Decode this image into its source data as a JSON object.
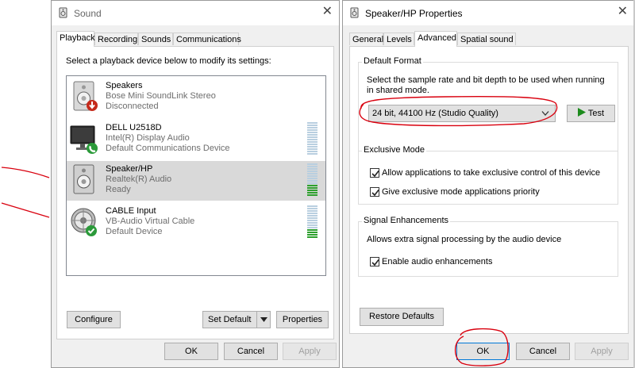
{
  "sound": {
    "title": "Sound",
    "tabs": [
      "Playback",
      "Recording",
      "Sounds",
      "Communications"
    ],
    "instruction": "Select a playback device below to modify its settings:",
    "devices": [
      {
        "name": "Speakers",
        "line2": "Bose Mini SoundLink Stereo",
        "line3": "Disconnected",
        "icon": "speaker-disconnected-icon",
        "status": "disconnected"
      },
      {
        "name": "DELL U2518D",
        "line2": "Intel(R) Display Audio",
        "line3": "Default Communications Device",
        "icon": "monitor-phone-icon",
        "status": "default-communications",
        "level": 0
      },
      {
        "name": "Speaker/HP",
        "line2": "Realtek(R) Audio",
        "line3": "Ready",
        "icon": "speaker-icon",
        "status": "ready",
        "selected": true,
        "level": 0.35
      },
      {
        "name": "CABLE Input",
        "line2": "VB-Audio Virtual Cable",
        "line3": "Default Device",
        "icon": "cable-default-icon",
        "status": "default",
        "level": 0.3
      }
    ],
    "buttons": {
      "configure": "Configure",
      "set_default": "Set Default",
      "properties": "Properties",
      "ok": "OK",
      "cancel": "Cancel",
      "apply": "Apply"
    }
  },
  "props": {
    "title": "Speaker/HP Properties",
    "tabs": [
      "General",
      "Levels",
      "Advanced",
      "Spatial sound"
    ],
    "default_format": {
      "group": "Default Format",
      "description": "Select the sample rate and bit depth to be used when running in shared mode.",
      "selected": "24 bit, 44100 Hz (Studio Quality)",
      "test": "Test"
    },
    "exclusive": {
      "group": "Exclusive Mode",
      "allow": "Allow applications to take exclusive control of this device",
      "priority": "Give exclusive mode applications priority"
    },
    "signal": {
      "group": "Signal Enhancements",
      "description": "Allows extra signal processing by the audio device",
      "enable": "Enable audio enhancements"
    },
    "restore": "Restore Defaults",
    "buttons": {
      "ok": "OK",
      "cancel": "Cancel",
      "apply": "Apply"
    }
  },
  "colors": {
    "annotation": "#d9000e",
    "accent": "#0078d7",
    "meter_green": "#2ea02e",
    "selected_row": "#d9d9d9",
    "checkmark": "#2b8a2b"
  }
}
